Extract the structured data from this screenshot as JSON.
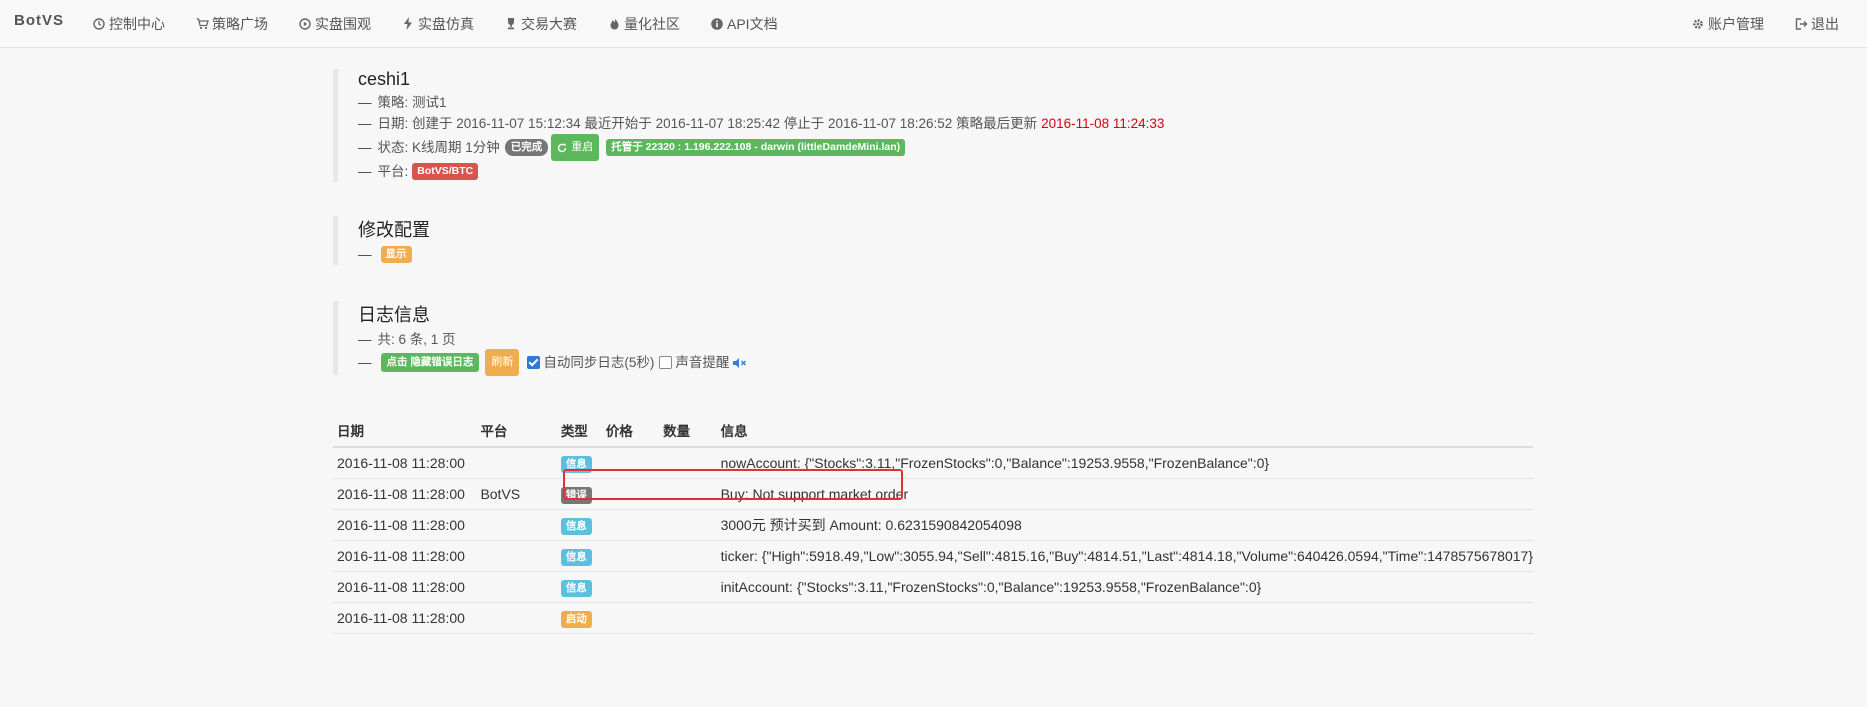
{
  "navbar": {
    "brand": "BotVS",
    "items": [
      {
        "label": "控制中心",
        "icon": "clock-icon"
      },
      {
        "label": "策略广场",
        "icon": "cart-icon"
      },
      {
        "label": "实盘围观",
        "icon": "play-circle-icon"
      },
      {
        "label": "实盘仿真",
        "icon": "bolt-icon"
      },
      {
        "label": "交易大赛",
        "icon": "trophy-icon"
      },
      {
        "label": "量化社区",
        "icon": "fire-icon"
      },
      {
        "label": "API文档",
        "icon": "info-circle-icon"
      }
    ],
    "right": [
      {
        "label": "账户管理",
        "icon": "gear-icon"
      },
      {
        "label": "退出",
        "icon": "sign-out-icon"
      }
    ]
  },
  "robot": {
    "name": "ceshi1",
    "strategy_label": "策略: 测试1",
    "date_label": "日期: 创建于 2016-11-07 15:12:34 最近开始于 2016-11-07 18:25:42 停止于 2016-11-07 18:26:52 策略最后更新",
    "last_update": "2016-11-08 11:24:33",
    "status_label": "状态: K线周期 1分钟",
    "status_badge": "已完成",
    "restart_button": "重启",
    "host_badge": "托管于 22320 : 1.196.222.108 - darwin (littleDamdeMini.lan)",
    "platform_label": "平台:",
    "platform_badge": "BotVS/BTC"
  },
  "config": {
    "title": "修改配置",
    "show_button": "显示"
  },
  "log": {
    "title": "日志信息",
    "count_label": "共: 6 条, 1 页",
    "hide_errors_button": "点击 隐藏错误日志",
    "refresh_button": "刷新",
    "auto_sync_label": "自动同步日志(5秒)",
    "auto_sync_checked": true,
    "sound_label": "声音提醒",
    "sound_checked": false
  },
  "table": {
    "headers": {
      "date": "日期",
      "platform": "平台",
      "type": "类型",
      "price": "价格",
      "quantity": "数量",
      "info": "信息"
    },
    "rows": [
      {
        "date": "2016-11-08 11:28:00",
        "platform": "",
        "type": "信息",
        "type_color": "#5bc0de",
        "price": "",
        "quantity": "",
        "info": "nowAccount: {\"Stocks\":3.11,\"FrozenStocks\":0,\"Balance\":19253.9558,\"FrozenBalance\":0}"
      },
      {
        "date": "2016-11-08 11:28:00",
        "platform": "BotVS",
        "type": "错误",
        "type_color": "#777777",
        "price": "",
        "quantity": "",
        "info": "Buy: Not support market order"
      },
      {
        "date": "2016-11-08 11:28:00",
        "platform": "",
        "type": "信息",
        "type_color": "#5bc0de",
        "price": "",
        "quantity": "",
        "info": "3000元 预计买到 Amount: 0.6231590842054098"
      },
      {
        "date": "2016-11-08 11:28:00",
        "platform": "",
        "type": "信息",
        "type_color": "#5bc0de",
        "price": "",
        "quantity": "",
        "info": "ticker: {\"High\":5918.49,\"Low\":3055.94,\"Sell\":4815.16,\"Buy\":4814.51,\"Last\":4814.18,\"Volume\":640426.0594,\"Time\":1478575678017}"
      },
      {
        "date": "2016-11-08 11:28:00",
        "platform": "",
        "type": "信息",
        "type_color": "#5bc0de",
        "price": "",
        "quantity": "",
        "info": "initAccount: {\"Stocks\":3.11,\"FrozenStocks\":0,\"Balance\":19253.9558,\"FrozenBalance\":0}"
      },
      {
        "date": "2016-11-08 11:28:00",
        "platform": "",
        "type": "启动",
        "type_color": "#f0ad4e",
        "price": "",
        "quantity": "",
        "info": ""
      }
    ]
  }
}
